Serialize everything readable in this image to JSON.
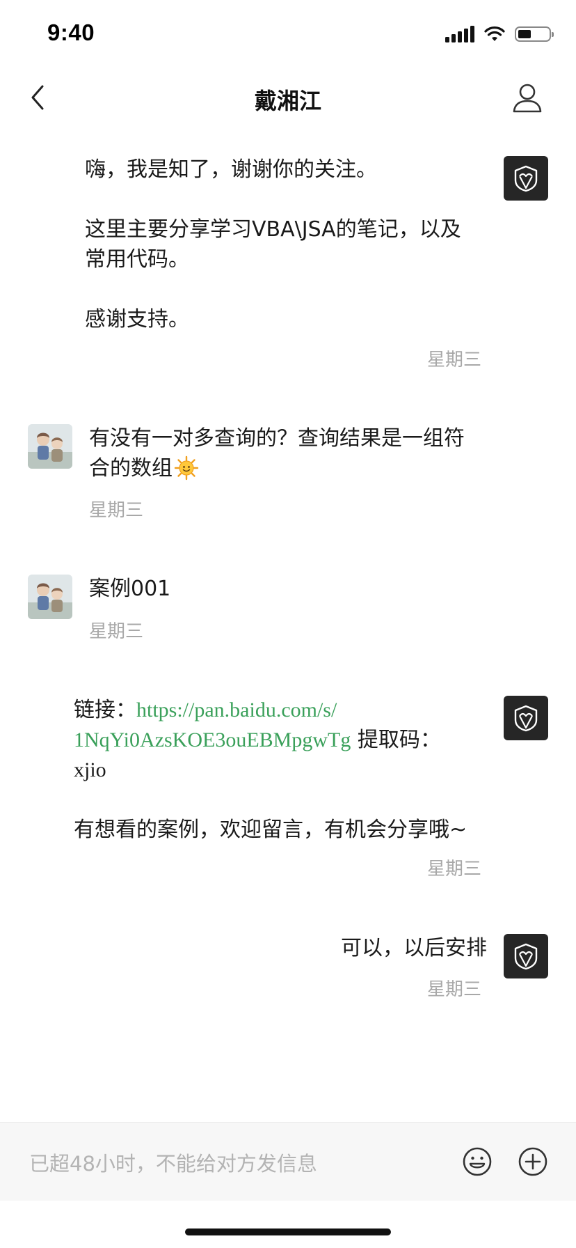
{
  "status_bar": {
    "time": "9:40"
  },
  "header": {
    "title": "戴湘江"
  },
  "messages": [
    {
      "side": "right",
      "lines": [
        "嗨，我是知了，谢谢你的关注。",
        "",
        "这里主要分享学习VBA\\JSA的笔记，以及",
        "常用代码。",
        "",
        "感谢支持。"
      ],
      "time": "星期三"
    },
    {
      "side": "left",
      "lines": [
        "有没有一对多查询的？查询结果是一组符",
        "合的数组"
      ],
      "emoji": "sun-face-emoji",
      "time": "星期三"
    },
    {
      "side": "left",
      "lines": [
        "案例001"
      ],
      "time": "星期三"
    },
    {
      "side": "right",
      "link_prefix": "链接：",
      "link_text_1": "https://pan.baidu.com/s/",
      "link_text_2": "1NqYi0AzsKOE3ouEBMpgwTg",
      "code_label": " 提取码：",
      "code_value": "xjio",
      "closing": "有想看的案例，欢迎留言，有机会分享哦~",
      "time": "星期三"
    },
    {
      "side": "right",
      "lines": [
        "可以，以后安排"
      ],
      "time": "星期三"
    }
  ],
  "input": {
    "placeholder": "已超48小时，不能给对方发信息"
  },
  "colors": {
    "link": "#3aa05a",
    "timestamp": "#a8a8a8",
    "bot_avatar_bg": "#262626",
    "input_bg": "#f7f7f7"
  }
}
